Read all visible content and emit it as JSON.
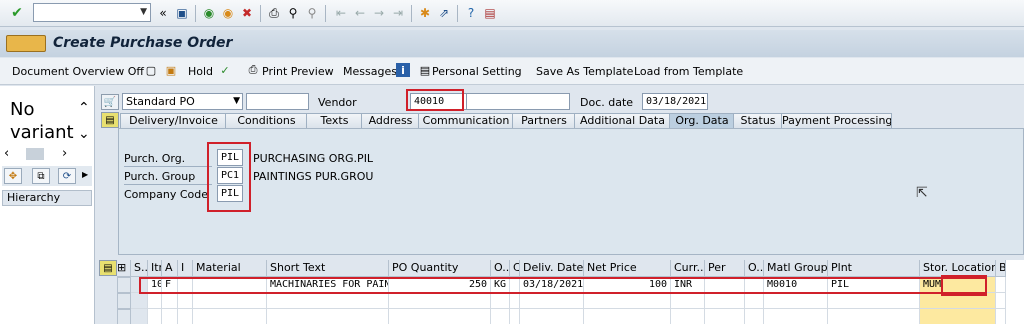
{
  "toolbar": {
    "command_field": "",
    "icons": [
      "enter-icon",
      "save-icon",
      "back-icon",
      "exit-icon",
      "cancel-icon",
      "print-icon",
      "find-icon",
      "find-next-icon",
      "first-page-icon",
      "prev-page-icon",
      "next-page-icon",
      "last-page-icon",
      "new-session-icon",
      "shortcut-icon",
      "help-icon",
      "customize-icon"
    ]
  },
  "title": "Create Purchase Order",
  "appbar": {
    "doc_overview": "Document Overview Off",
    "hold": "Hold",
    "print_preview": "Print Preview",
    "messages": "Messages",
    "personal_setting": "Personal Setting",
    "save_as_template": "Save As Template",
    "load_from_template": "Load from Template"
  },
  "left_pane": {
    "no_variant": "No variant",
    "hierarchy": "Hierarchy"
  },
  "header": {
    "po_type": "Standard PO",
    "vendor_label": "Vendor",
    "vendor_value": "40010",
    "doc_date_label": "Doc. date",
    "doc_date_value": "03/18/2021"
  },
  "tabs": [
    "Delivery/Invoice",
    "Conditions",
    "Texts",
    "Address",
    "Communication",
    "Partners",
    "Additional Data",
    "Org. Data",
    "Status",
    "Payment Processing"
  ],
  "org_data": {
    "purch_org_label": "Purch. Org.",
    "purch_org_value": "PIL",
    "purch_org_text": "PURCHASING ORG.PIL",
    "purch_group_label": "Purch. Group",
    "purch_group_value": "PC1",
    "purch_group_text": "PAINTINGS PUR.GROU",
    "company_code_label": "Company Code",
    "company_code_value": "PIL"
  },
  "items": {
    "columns": [
      "S..",
      "Itm",
      "A",
      "I",
      "Material",
      "Short Text",
      "PO Quantity",
      "O...",
      "C",
      "Deliv. Date",
      "Net Price",
      "Curr...",
      "Per",
      "O...",
      "Matl Group",
      "Plnt",
      "Stor. Location",
      "B"
    ],
    "rows": [
      [
        "",
        "10",
        "F",
        "",
        "",
        "MACHINARIES FOR PAIN...",
        "250",
        "KG",
        "",
        "03/18/2021",
        "100",
        "INR",
        "",
        "",
        "M0010",
        "PIL",
        "MUM",
        ""
      ]
    ]
  },
  "colors": {
    "highlight": "#d0202a",
    "accent": "#e8b64a"
  }
}
